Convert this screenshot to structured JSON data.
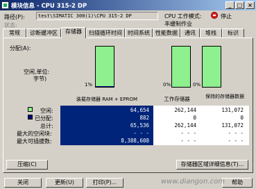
{
  "window": {
    "title": "模块信息 - CPU 315-2 DP",
    "minimize": "_",
    "maximize": "□",
    "close": "×"
  },
  "info": {
    "path_label": "路径(P):",
    "path_value": "test\\SIMATIC 300(1)\\CPU 315-2 DP",
    "status_label": "状态:",
    "mode_label": "CPU 工作模式:",
    "mode_value": "停止",
    "mode_sub": "丰缓制作业"
  },
  "tabs": [
    "常规",
    "诊断缓冲区",
    "存储器",
    "扫描循环时间",
    "时间系统",
    "性能数据",
    "通讯",
    "堆栈",
    "标识"
  ],
  "active_tab": 2,
  "memory": {
    "allocation_label": "分配(A):",
    "free_label_1": "空闲,单位:",
    "free_label_2": "字节)",
    "gauges": [
      {
        "percent_label": "1%",
        "used_fraction": 0.01
      },
      {
        "percent_label": "0%",
        "used_fraction": 0.0
      },
      {
        "percent_label": "0%",
        "used_fraction": 0.0
      }
    ],
    "columns": [
      "装载存储器 RAM + EPROM",
      "工作存储器",
      "保持的存储器数据"
    ],
    "rows": [
      {
        "label": "空闲:",
        "values": [
          "64,654",
          "262,144",
          "131,072"
        ]
      },
      {
        "label": "已分配:",
        "values": [
          "882",
          "0",
          "0"
        ]
      },
      {
        "label": "总计:",
        "values": [
          "65,536",
          "262,144",
          "131,072"
        ]
      },
      {
        "label": "最大的空闲块:",
        "values": [
          "- - -",
          "- - -",
          "- - -"
        ]
      },
      {
        "label": "最大可插拔数:",
        "values": [
          "8,388,608",
          "- - -",
          "- - -"
        ]
      }
    ],
    "compress_button": "压缩(C)",
    "detail_button": "存储器区域详细信息(T)..."
  },
  "footer": {
    "close": "关闭",
    "update": "更新(U)",
    "print": "打印(P)...",
    "help": "帮助"
  },
  "watermark": "www.diangon.com",
  "colors": {
    "free": "#8ef08e",
    "allocated": "#000080"
  }
}
